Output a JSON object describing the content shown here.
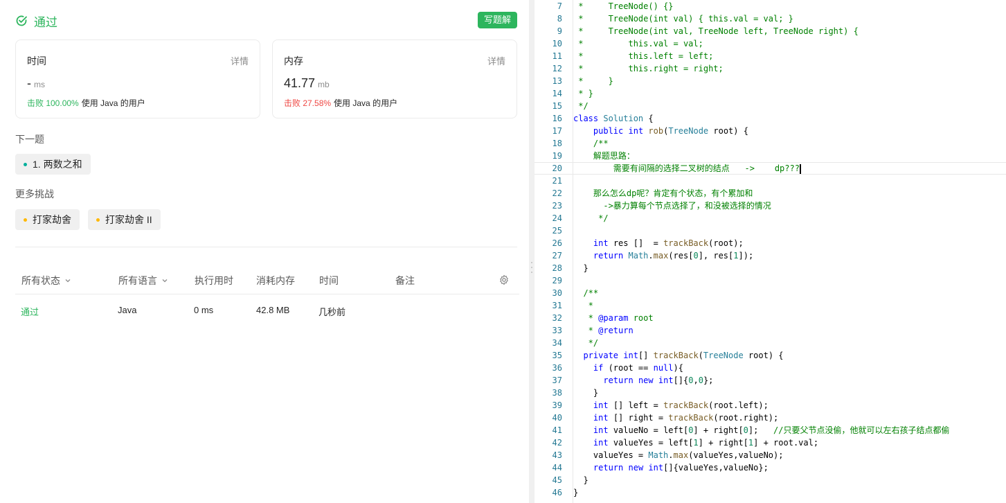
{
  "status": {
    "title": "通过",
    "write_solution": "写题解"
  },
  "time_card": {
    "title": "时间",
    "detail": "详情",
    "value": "-",
    "unit": "ms",
    "beat": "击败 100.00%",
    "beat_rest": "使用 Java 的用户"
  },
  "memory_card": {
    "title": "内存",
    "detail": "详情",
    "value": "41.77",
    "unit": "mb",
    "beat": "击败 27.58%",
    "beat_rest": "使用 Java 的用户"
  },
  "next_problem": {
    "label": "下一题",
    "item": "1. 两数之和"
  },
  "more_challenges": {
    "label": "更多挑战",
    "items": [
      "打家劫舍",
      "打家劫舍 II"
    ]
  },
  "table": {
    "headers": [
      "所有状态",
      "所有语言",
      "执行用时",
      "消耗内存",
      "时间",
      "备注"
    ],
    "rows": [
      {
        "status": "通过",
        "lang": "Java",
        "runtime": "0 ms",
        "memory": "42.8 MB",
        "time": "几秒前",
        "note": ""
      }
    ]
  },
  "colors": {
    "accent": "#2db55d",
    "danger": "#ef4743",
    "chip_bg": "#f0f0f0"
  },
  "icons": [
    "check-circle-icon",
    "chevron-down-icon",
    "gear-icon"
  ],
  "code": {
    "lines": [
      {
        "n": "7",
        "t": " *     TreeNode() {}",
        "k": "c"
      },
      {
        "n": "8",
        "t": " *     TreeNode(int val) { this.val = val; }",
        "k": "c"
      },
      {
        "n": "9",
        "t": " *     TreeNode(int val, TreeNode left, TreeNode right) {",
        "k": "c"
      },
      {
        "n": "10",
        "t": " *         this.val = val;",
        "k": "c"
      },
      {
        "n": "11",
        "t": " *         this.left = left;",
        "k": "c"
      },
      {
        "n": "12",
        "t": " *         this.right = right;",
        "k": "c"
      },
      {
        "n": "13",
        "t": " *     }",
        "k": "c"
      },
      {
        "n": "14",
        "t": " * }",
        "k": "c"
      },
      {
        "n": "15",
        "t": " */",
        "k": "c"
      },
      {
        "n": "16",
        "t": "class Solution {",
        "k": "p"
      },
      {
        "n": "17",
        "t": "    public int rob(TreeNode root) {",
        "k": "p"
      },
      {
        "n": "18",
        "t": "    /**",
        "k": "c"
      },
      {
        "n": "19",
        "t": "    解题思路：",
        "k": "c"
      },
      {
        "n": "20",
        "t": "        需要有间隔的选择二叉树的结点   ->    dp???",
        "k": "c"
      },
      {
        "n": "21",
        "t": "",
        "k": "c"
      },
      {
        "n": "22",
        "t": "    那么怎么dp呢？肯定有个状态，有个累加和",
        "k": "c"
      },
      {
        "n": "23",
        "t": "      ->暴力算每个节点选择了，和没被选择的情况",
        "k": "c"
      },
      {
        "n": "24",
        "t": "     */",
        "k": "c"
      },
      {
        "n": "25",
        "t": "",
        "k": "p"
      },
      {
        "n": "26",
        "t": "    int res []  = trackBack(root);",
        "k": "p"
      },
      {
        "n": "27",
        "t": "    return Math.max(res[0], res[1]);",
        "k": "p"
      },
      {
        "n": "28",
        "t": "  }",
        "k": "p"
      },
      {
        "n": "29",
        "t": "",
        "k": "p"
      },
      {
        "n": "30",
        "t": "  /**",
        "k": "c"
      },
      {
        "n": "31",
        "t": "   *",
        "k": "c"
      },
      {
        "n": "32",
        "t": "   * @param root",
        "k": "c"
      },
      {
        "n": "33",
        "t": "   * @return",
        "k": "c"
      },
      {
        "n": "34",
        "t": "   */",
        "k": "c"
      },
      {
        "n": "35",
        "t": "  private int[] trackBack(TreeNode root) {",
        "k": "p"
      },
      {
        "n": "36",
        "t": "    if (root == null){",
        "k": "p"
      },
      {
        "n": "37",
        "t": "      return new int[]{0,0};",
        "k": "p"
      },
      {
        "n": "38",
        "t": "    }",
        "k": "p"
      },
      {
        "n": "39",
        "t": "    int [] left = trackBack(root.left);",
        "k": "p"
      },
      {
        "n": "40",
        "t": "    int [] right = trackBack(root.right);",
        "k": "p"
      },
      {
        "n": "41",
        "t": "    int valueNo = left[0] + right[0];   //只要父节点没偷，他就可以左右孩子结点都偷",
        "k": "p"
      },
      {
        "n": "42",
        "t": "    int valueYes = left[1] + right[1] + root.val;",
        "k": "p"
      },
      {
        "n": "43",
        "t": "    valueYes = Math.max(valueYes,valueNo);",
        "k": "p"
      },
      {
        "n": "44",
        "t": "    return new int[]{valueYes,valueNo};",
        "k": "p"
      },
      {
        "n": "45",
        "t": "  }",
        "k": "p"
      },
      {
        "n": "46",
        "t": "}",
        "k": "p"
      }
    ]
  }
}
